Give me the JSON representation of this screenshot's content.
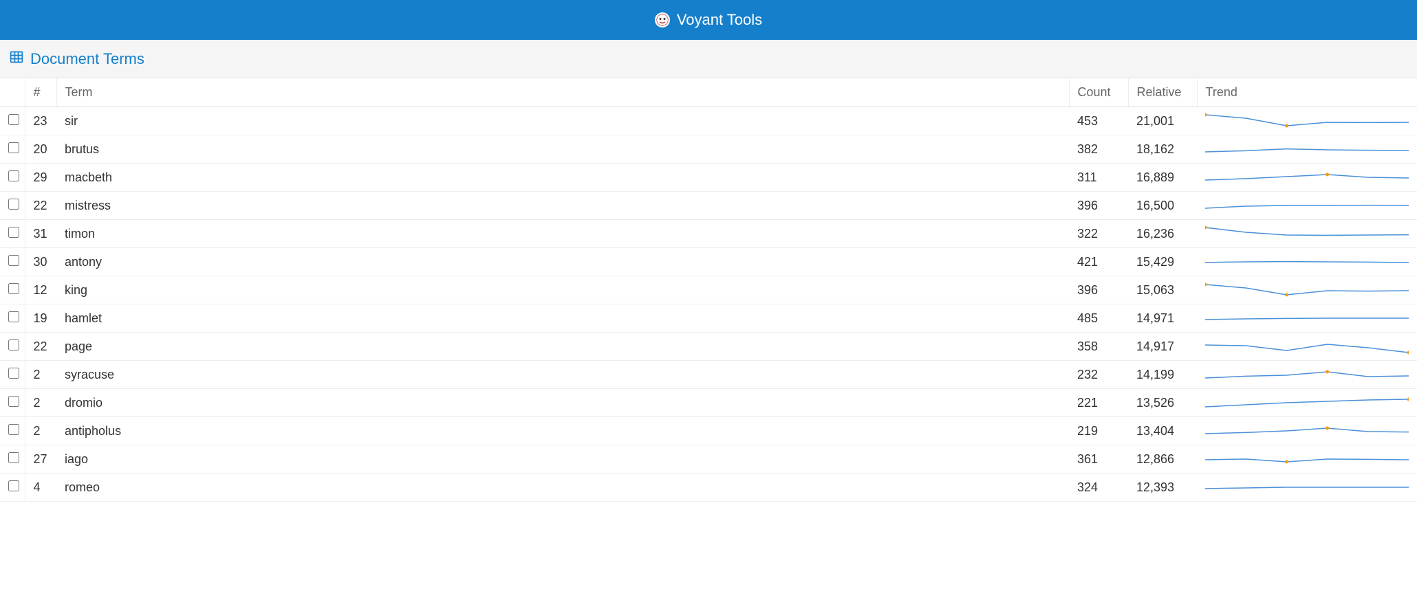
{
  "header": {
    "title": "Voyant Tools"
  },
  "panel": {
    "title": "Document Terms"
  },
  "columns": {
    "num": "#",
    "term": "Term",
    "count": "Count",
    "relative": "Relative",
    "trend": "Trend"
  },
  "rows": [
    {
      "num": "23",
      "term": "sir",
      "count": "453",
      "relative": "21,001",
      "trend": [
        0.05,
        0.3,
        0.85,
        0.6,
        0.62,
        0.6
      ],
      "peaks": [
        0,
        2
      ]
    },
    {
      "num": "20",
      "term": "brutus",
      "count": "382",
      "relative": "18,162",
      "trend": [
        0.7,
        0.62,
        0.48,
        0.55,
        0.58,
        0.6
      ],
      "peaks": []
    },
    {
      "num": "29",
      "term": "macbeth",
      "count": "311",
      "relative": "16,889",
      "trend": [
        0.7,
        0.6,
        0.45,
        0.3,
        0.5,
        0.55
      ],
      "peaks": [
        3
      ]
    },
    {
      "num": "22",
      "term": "mistress",
      "count": "396",
      "relative": "16,500",
      "trend": [
        0.7,
        0.55,
        0.5,
        0.5,
        0.48,
        0.5
      ],
      "peaks": []
    },
    {
      "num": "31",
      "term": "timon",
      "count": "322",
      "relative": "16,236",
      "trend": [
        0.05,
        0.4,
        0.6,
        0.62,
        0.6,
        0.58
      ],
      "peaks": [
        0
      ]
    },
    {
      "num": "30",
      "term": "antony",
      "count": "421",
      "relative": "15,429",
      "trend": [
        0.55,
        0.5,
        0.48,
        0.5,
        0.52,
        0.55
      ],
      "peaks": []
    },
    {
      "num": "12",
      "term": "king",
      "count": "396",
      "relative": "15,063",
      "trend": [
        0.1,
        0.35,
        0.85,
        0.55,
        0.58,
        0.55
      ],
      "peaks": [
        0,
        2
      ]
    },
    {
      "num": "19",
      "term": "hamlet",
      "count": "485",
      "relative": "14,971",
      "trend": [
        0.6,
        0.55,
        0.52,
        0.5,
        0.5,
        0.5
      ],
      "peaks": []
    },
    {
      "num": "22",
      "term": "page",
      "count": "358",
      "relative": "14,917",
      "trend": [
        0.4,
        0.45,
        0.8,
        0.35,
        0.6,
        0.95
      ],
      "peaks": [
        5
      ]
    },
    {
      "num": "2",
      "term": "syracuse",
      "count": "232",
      "relative": "14,199",
      "trend": [
        0.75,
        0.62,
        0.55,
        0.3,
        0.65,
        0.6
      ],
      "peaks": [
        3
      ]
    },
    {
      "num": "2",
      "term": "dromio",
      "count": "221",
      "relative": "13,526",
      "trend": [
        0.8,
        0.65,
        0.5,
        0.4,
        0.3,
        0.25
      ],
      "peaks": [
        5
      ]
    },
    {
      "num": "2",
      "term": "antipholus",
      "count": "219",
      "relative": "13,404",
      "trend": [
        0.7,
        0.62,
        0.5,
        0.3,
        0.55,
        0.58
      ],
      "peaks": [
        3
      ]
    },
    {
      "num": "27",
      "term": "iago",
      "count": "361",
      "relative": "12,866",
      "trend": [
        0.55,
        0.5,
        0.7,
        0.5,
        0.52,
        0.55
      ],
      "peaks": [
        2
      ]
    },
    {
      "num": "4",
      "term": "romeo",
      "count": "324",
      "relative": "12,393",
      "trend": [
        0.6,
        0.55,
        0.5,
        0.5,
        0.5,
        0.5
      ],
      "peaks": []
    }
  ]
}
